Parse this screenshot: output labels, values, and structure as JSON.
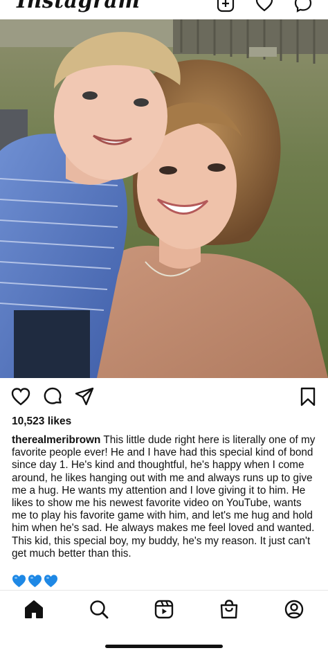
{
  "app": {
    "logo_text": "Instagram"
  },
  "post": {
    "likes_text": "10,523 likes",
    "username": "therealmeribrown",
    "caption": "This little dude right here is literally one of my favorite people ever! He and I have had this special kind of bond since day 1. He's kind and thoughtful, he's happy when I come around, he likes hanging out with me and always runs up to give me a hug. He wants my attention and I love giving it to him. He likes to show me his newest favorite video on YouTube, wants me to play his favorite game with him, and let's me hug and hold him when he's sad. He always makes me feel loved and wanted. This kid, this special boy, my buddy, he's my reason. It just can't get much better than this.",
    "emoji_hearts": [
      "blue-heart",
      "blue-heart",
      "blue-heart"
    ],
    "image": "selfie of a smiling boy in a blue striped shirt and a smiling woman in a tan top, outdoors on grass"
  },
  "icons": {
    "top": [
      "new-post-icon",
      "heart-icon",
      "messenger-icon"
    ],
    "actions": [
      "like-heart-icon",
      "comment-icon",
      "share-icon",
      "bookmark-icon"
    ],
    "tabs": [
      "home-icon",
      "search-icon",
      "reels-icon",
      "shop-icon",
      "profile-icon"
    ]
  },
  "colors": {
    "heart_blue": "#1e88e5",
    "text": "#111111",
    "divider": "#e6e6e6"
  }
}
